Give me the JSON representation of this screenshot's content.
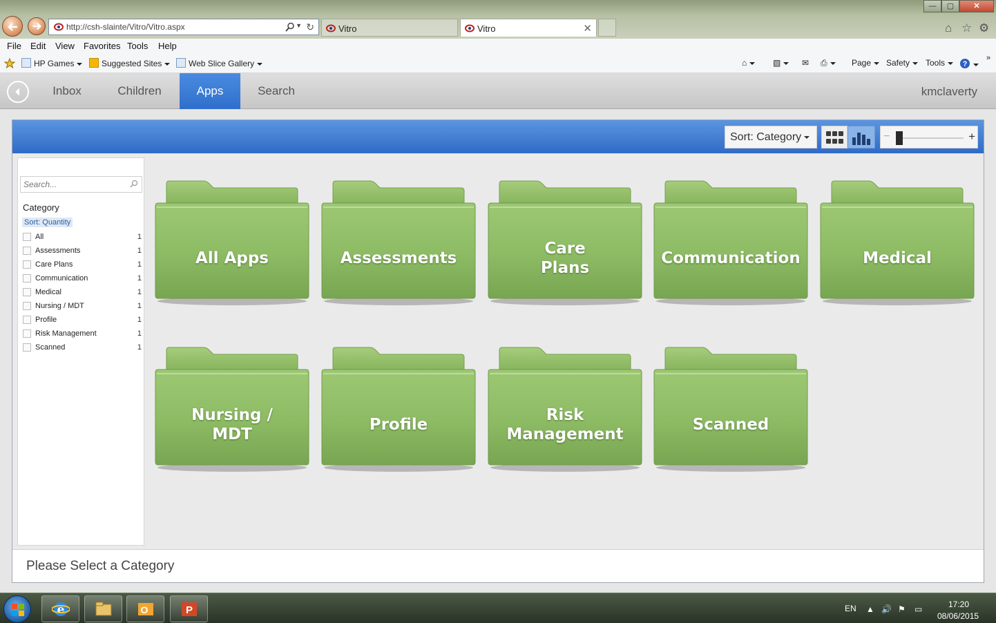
{
  "browser": {
    "address": "http://csh-slainte/Vitro/Vitro.aspx",
    "tabs": [
      {
        "label": "Vitro"
      },
      {
        "label": "Vitro"
      }
    ],
    "tab_close": "✕",
    "window_controls": {
      "minimize": "—",
      "maximize": "▢",
      "close": "✕"
    }
  },
  "menubar": {
    "items": [
      "File",
      "Edit",
      "View",
      "Favorites",
      "Tools",
      "Help"
    ]
  },
  "favbar": {
    "left": [
      "HP Games",
      "Suggested Sites",
      "Web Slice Gallery"
    ],
    "right": [
      "Page",
      "Safety",
      "Tools"
    ]
  },
  "app": {
    "nav": [
      "Inbox",
      "Children",
      "Apps",
      "Search"
    ],
    "active_nav": "Apps",
    "user": "kmclaverty",
    "sort_label": "Sort: Category",
    "zoom_minus": "−",
    "zoom_plus": "+",
    "sidebar": {
      "search_placeholder": "Search...",
      "heading": "Category",
      "sort_link": "Sort: Quantity",
      "categories": [
        {
          "label": "All",
          "count": "1"
        },
        {
          "label": "Assessments",
          "count": "1"
        },
        {
          "label": "Care Plans",
          "count": "1"
        },
        {
          "label": "Communication",
          "count": "1"
        },
        {
          "label": "Medical",
          "count": "1"
        },
        {
          "label": "Nursing / MDT",
          "count": "1"
        },
        {
          "label": "Profile",
          "count": "1"
        },
        {
          "label": "Risk Management",
          "count": "1"
        },
        {
          "label": "Scanned",
          "count": "1"
        }
      ]
    },
    "folders": [
      {
        "line1": "All Apps",
        "line2": ""
      },
      {
        "line1": "Assessments",
        "line2": ""
      },
      {
        "line1": "Care",
        "line2": "Plans"
      },
      {
        "line1": "Communication",
        "line2": ""
      },
      {
        "line1": "Medical",
        "line2": ""
      },
      {
        "line1": "Nursing /",
        "line2": "MDT"
      },
      {
        "line1": "Profile",
        "line2": ""
      },
      {
        "line1": "Risk",
        "line2": "Management"
      },
      {
        "line1": "Scanned",
        "line2": ""
      }
    ],
    "status": "Please Select a Category"
  },
  "taskbar": {
    "lang": "EN",
    "time": "17:20",
    "date": "08/06/2015"
  },
  "colors": {
    "accent_blue": "#2f6fcc",
    "folder_green": "#8dbb64"
  }
}
